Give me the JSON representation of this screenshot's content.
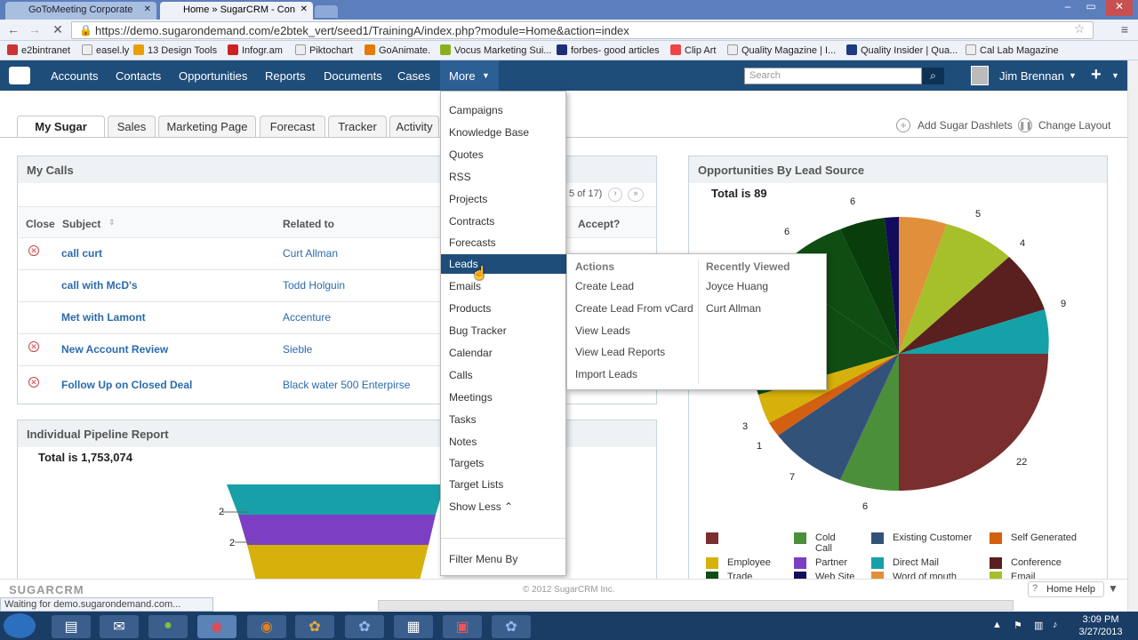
{
  "browser": {
    "tabs": [
      {
        "label": "GoToMeeting Corporate"
      },
      {
        "label": "Home » SugarCRM - Con"
      }
    ],
    "url": "https://demo.sugarondemand.com/e2btek_vert/seed1/TrainingA/index.php?module=Home&action=index",
    "bookmarks": [
      "e2bintranet",
      "easel.ly",
      "13 Design Tools",
      "Infogr.am",
      "Piktochart",
      "GoAnimate.",
      "Vocus Marketing Sui...",
      "forbes- good articles",
      "Clip Art",
      "Quality Magazine | I...",
      "Quality Insider | Qua...",
      "Cal Lab Magazine"
    ],
    "status": "Waiting for demo.sugarondemand.com..."
  },
  "sugar": {
    "nav": [
      "Accounts",
      "Contacts",
      "Opportunities",
      "Reports",
      "Documents",
      "Cases"
    ],
    "more": "More",
    "search_placeholder": "Search",
    "user": "Jim Brennan",
    "plus": "+"
  },
  "dashboard": {
    "tabs": [
      "My Sugar",
      "Sales",
      "Marketing Page",
      "Forecast",
      "Tracker",
      "Activity"
    ],
    "add_dashlets": "Add Sugar Dashlets",
    "change_layout": "Change Layout"
  },
  "my_calls": {
    "title": "My Calls",
    "pagination": "5 of 17)",
    "headers": {
      "close": "Close",
      "subject": "Subject",
      "related": "Related to",
      "accept": "Accept?"
    },
    "rows": [
      {
        "subject": "call curt",
        "related": "Curt Allman",
        "x": true
      },
      {
        "subject": "call with McD's",
        "related": "Todd Holguin",
        "x": false
      },
      {
        "subject": "Met with Lamont",
        "related": "Accenture",
        "x": false
      },
      {
        "subject": "New Account Review",
        "related": "Sieble",
        "x": true
      },
      {
        "subject": "Follow Up on Closed Deal",
        "related": "Black water 500 Enterpirse",
        "x": true
      }
    ]
  },
  "pipeline": {
    "title": "Individual Pipeline Report",
    "total": "Total is 1,753,074",
    "labels": [
      "2",
      "2"
    ]
  },
  "opportunities": {
    "title": "Opportunities By Lead Source",
    "total": "Total is 89",
    "slice_labels": [
      "6",
      "5",
      "4",
      "9",
      "22",
      "6",
      "7",
      "1",
      "3",
      "6"
    ],
    "legend": [
      "",
      "Cold Call",
      "Existing Customer",
      "Self Generated",
      "Employee",
      "Partner",
      "Direct Mail",
      "Conference",
      "Trade",
      "Web Site",
      "Word of mouth",
      "Email"
    ],
    "legend_colors": [
      "#7a2e2e",
      "#4b8f3a",
      "#33527a",
      "#d35f10",
      "#d6b10c",
      "#7c3fc4",
      "#16a0a8",
      "#5a1f1f",
      "#0f4d12",
      "#130b5c",
      "#e0903a",
      "#a5c02a"
    ]
  },
  "more_menu": {
    "items": [
      "Campaigns",
      "Knowledge Base",
      "Quotes",
      "RSS",
      "Projects",
      "Contracts",
      "Forecasts",
      "Leads",
      "Emails",
      "Products",
      "Bug Tracker",
      "Calendar",
      "Calls",
      "Meetings",
      "Tasks",
      "Notes",
      "Targets",
      "Target Lists",
      "Show Less ⌃"
    ],
    "highlighted": "Leads",
    "filter": "Filter Menu By"
  },
  "leads_flyout": {
    "actions_title": "Actions",
    "actions": [
      "Create Lead",
      "Create Lead From vCard",
      "View Leads",
      "View Lead Reports",
      "Import Leads"
    ],
    "recent_title": "Recently Viewed",
    "recent": [
      "Joyce Huang",
      "Curt Allman"
    ]
  },
  "footer": {
    "logo": "SUGARCRM",
    "copyright": "© 2012 SugarCRM Inc.",
    "help": "Home Help"
  },
  "taskbar": {
    "time": "3:09 PM",
    "date": "3/27/2013"
  }
}
